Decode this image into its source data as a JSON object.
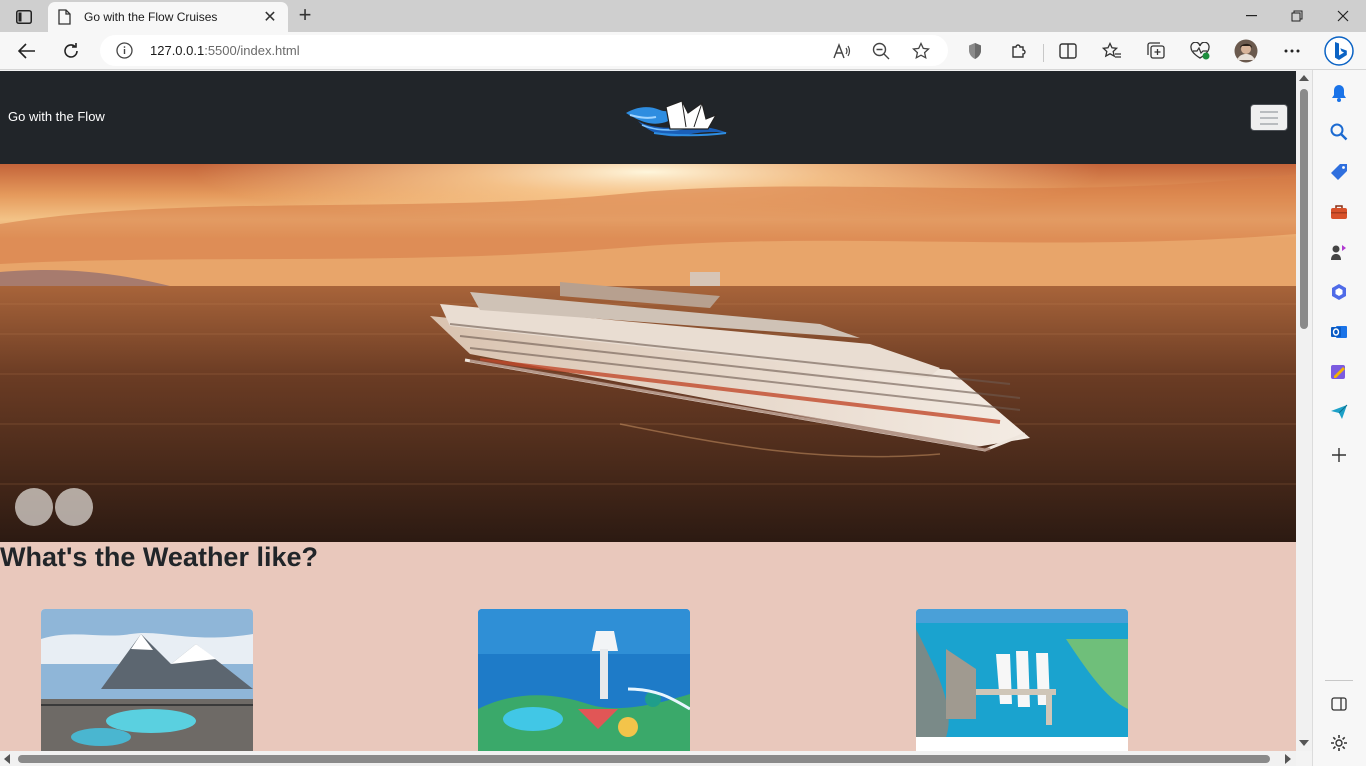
{
  "browser": {
    "tab_title": "Go with the Flow Cruises",
    "url_host": "127.0.0.1",
    "url_path": ":5500/index.html"
  },
  "site": {
    "brand": "Go with the Flow",
    "hero_alt": "Cruise ship at sunset",
    "section_title": "What's the Weather like?",
    "cards": [
      {
        "image": "Alaska glacier pool deck"
      },
      {
        "image": "Caribbean island water park"
      },
      {
        "image": "Nassau cruise port"
      }
    ],
    "carousel_slides": 2
  },
  "icons": {
    "tab_actions": "tab-actions-icon",
    "page": "page-icon",
    "back": "back-arrow-icon",
    "refresh": "refresh-icon",
    "info": "site-info-icon",
    "read_aloud": "read-aloud-icon",
    "zoom": "zoom-out-icon",
    "favorite": "star-icon",
    "shield": "shield-icon",
    "extensions": "puzzle-icon",
    "split": "split-screen-icon",
    "favorites": "favorites-icon",
    "collections": "collections-icon",
    "performance": "heartbeat-icon",
    "profile": "profile-avatar",
    "more": "more-icon",
    "copilot": "bing-copilot-icon"
  },
  "colors": {
    "navbar": "#212529",
    "page_bg": "#e9c8bc",
    "accent": "#0b63c4"
  }
}
